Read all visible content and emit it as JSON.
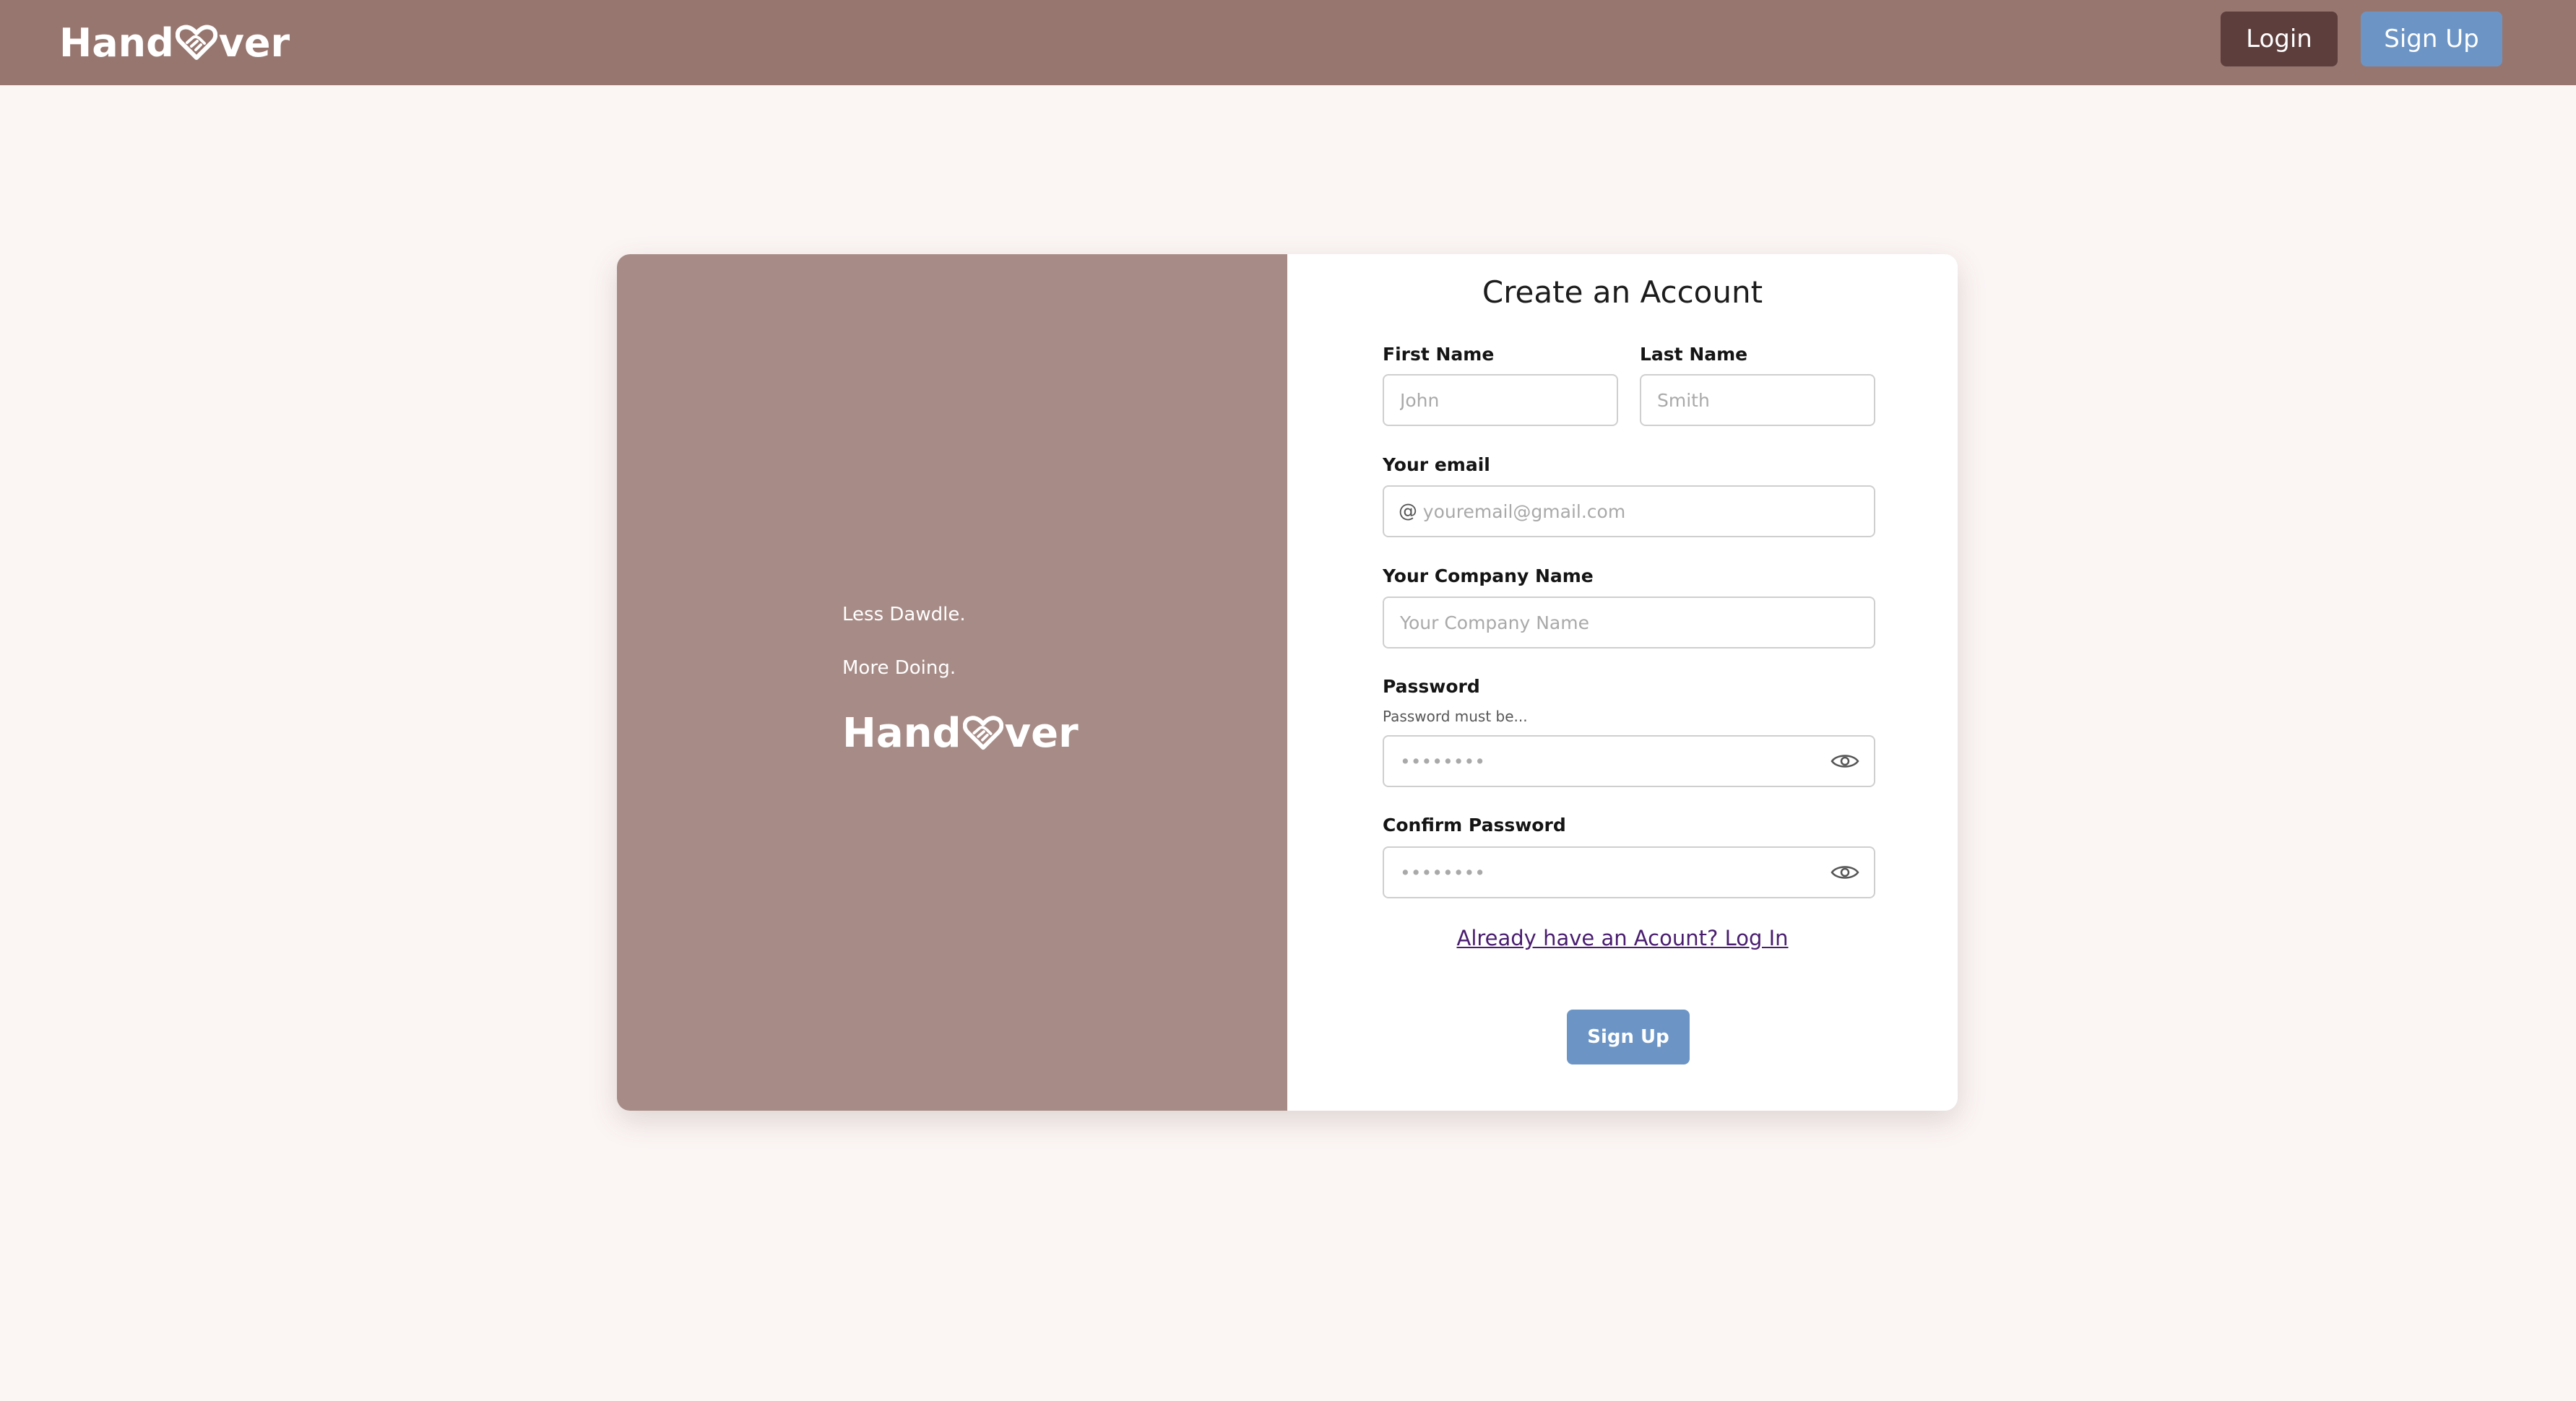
{
  "header": {
    "brand_left": "Hand",
    "brand_right": "ver",
    "login_label": "Login",
    "signup_label": "Sign Up"
  },
  "hero": {
    "tagline_1": "Less Dawdle.",
    "tagline_2": "More Doing.",
    "brand_left": "Hand",
    "brand_right": "ver"
  },
  "form": {
    "title": "Create an Account",
    "first_name": {
      "label": "First Name",
      "placeholder": "John"
    },
    "last_name": {
      "label": "Last Name",
      "placeholder": "Smith"
    },
    "email": {
      "label": "Your email",
      "placeholder": "youremail@gmail.com",
      "prefix": "@"
    },
    "company": {
      "label": "Your Company Name",
      "placeholder": "Your Company Name"
    },
    "password": {
      "label": "Password",
      "hint": "Password must be...",
      "placeholder": "••••••••"
    },
    "confirm_password": {
      "label": "Confirm Password",
      "placeholder": "••••••••"
    },
    "login_link": "Already have an Acount? Log In",
    "submit_label": "Sign Up"
  },
  "colors": {
    "header_bg": "#97766f",
    "hero_bg": "#a78b86",
    "page_bg": "#fbf5f4",
    "login_button": "#5e3e3c",
    "accent_blue": "#6c95c6",
    "link": "#4a1d6f"
  },
  "icons": [
    "heart-handshake-icon",
    "eye-icon"
  ]
}
